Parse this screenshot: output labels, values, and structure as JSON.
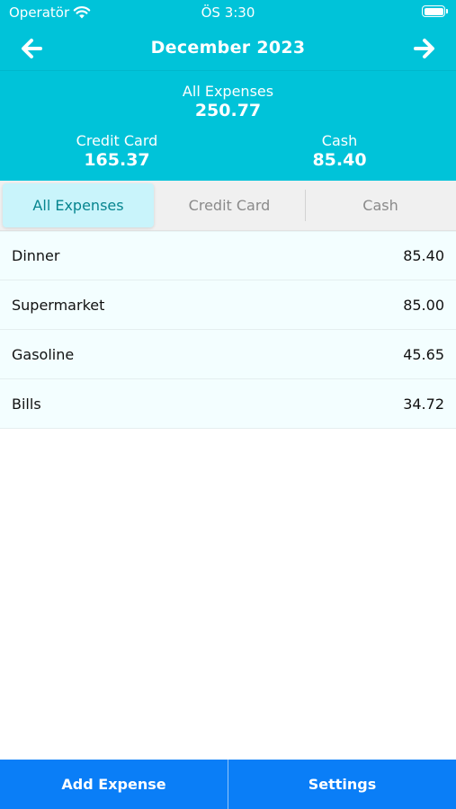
{
  "status_bar": {
    "carrier": "Operatör",
    "time": "ÖS 3:30"
  },
  "header": {
    "month_title": "December 2023",
    "all_label": "All Expenses",
    "all_value": "250.77",
    "credit_label": "Credit Card",
    "credit_value": "165.37",
    "cash_label": "Cash",
    "cash_value": "85.40"
  },
  "segments": [
    {
      "label": "All Expenses",
      "selected": true
    },
    {
      "label": "Credit Card",
      "selected": false
    },
    {
      "label": "Cash",
      "selected": false
    }
  ],
  "expenses": [
    {
      "name": "Dinner",
      "amount": "85.40"
    },
    {
      "name": "Supermarket",
      "amount": "85.00"
    },
    {
      "name": "Gasoline",
      "amount": "45.65"
    },
    {
      "name": "Bills",
      "amount": "34.72"
    }
  ],
  "tab_bar": {
    "add_label": "Add Expense",
    "settings_label": "Settings"
  },
  "colors": {
    "header": "#00c3d9",
    "tab_bar": "#0a7ef7",
    "segment_active": "#c9f4fb",
    "row_bg": "#f3feff"
  },
  "icons": {
    "previous": "arrow-left-icon",
    "next": "arrow-right-icon",
    "wifi": "wifi-icon",
    "battery": "battery-icon"
  }
}
